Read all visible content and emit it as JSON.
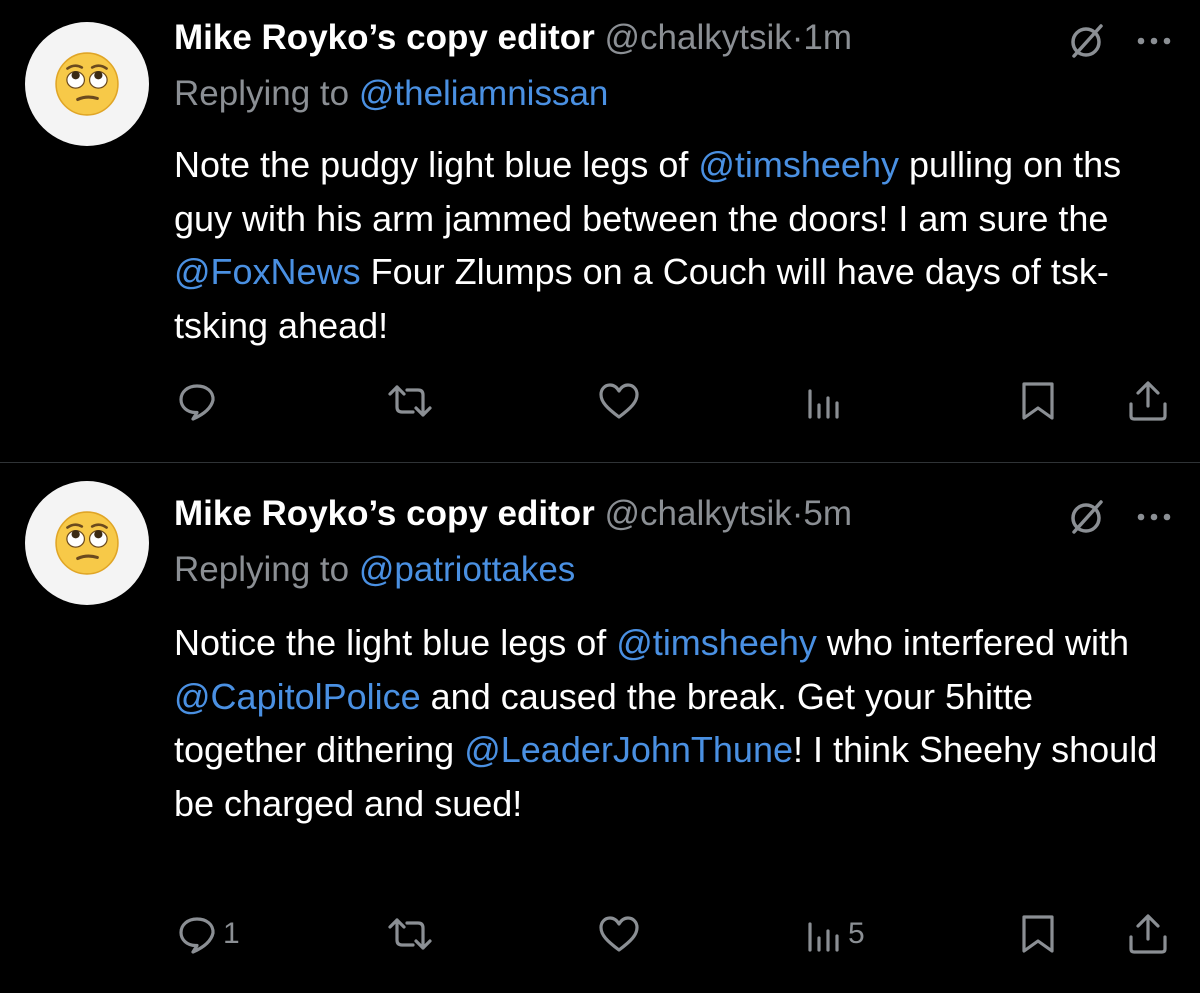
{
  "tweets": [
    {
      "author_name": "Mike Royko’s copy editor",
      "handle": "@chalkytsik",
      "separator": "·",
      "time": "1m",
      "replying_prefix": "Replying to",
      "replying_to": "@theliamnissan",
      "text": [
        {
          "t": "Note the pudgy light blue legs of "
        },
        {
          "t": "@timsheehy",
          "mention": true
        },
        {
          "t": " pulling on ths guy with his arm jammed between the doors! I am sure the "
        },
        {
          "t": "@FoxNews",
          "mention": true
        },
        {
          "t": " Four Zlumps on a Couch will have days of tsk-tsking ahead!"
        }
      ],
      "reply_count": "",
      "repost_count": "",
      "like_count": "",
      "view_count": ""
    },
    {
      "author_name": "Mike Royko’s copy editor",
      "handle": "@chalkytsik",
      "separator": "·",
      "time": "5m",
      "replying_prefix": "Replying to",
      "replying_to": "@patriottakes",
      "text": [
        {
          "t": "Notice the light blue legs of "
        },
        {
          "t": "@timsheehy",
          "mention": true
        },
        {
          "t": " who interfered with "
        },
        {
          "t": "@CapitolPolice",
          "mention": true
        },
        {
          "t": " and caused the break. Get your 5hitte together dithering "
        },
        {
          "t": "@LeaderJohnThune",
          "mention": true
        },
        {
          "t": "! I think Sheehy should be charged and sued!"
        }
      ],
      "reply_count": "1",
      "repost_count": "",
      "like_count": "",
      "view_count": "5"
    }
  ],
  "icons": {
    "avatar": "face-with-rolling-eyes-emoji",
    "grok": "grok-icon",
    "more": "more-options-icon",
    "reply": "reply-icon",
    "repost": "repost-icon",
    "like": "heart-icon",
    "views": "views-icon",
    "bookmark": "bookmark-icon",
    "share": "share-icon"
  },
  "colors": {
    "background": "#000000",
    "text": "#ffffff",
    "secondary": "#8b8f94",
    "mention": "#4a90e2",
    "divider": "#2f3336",
    "avatar_bg": "#f4f4f4"
  }
}
